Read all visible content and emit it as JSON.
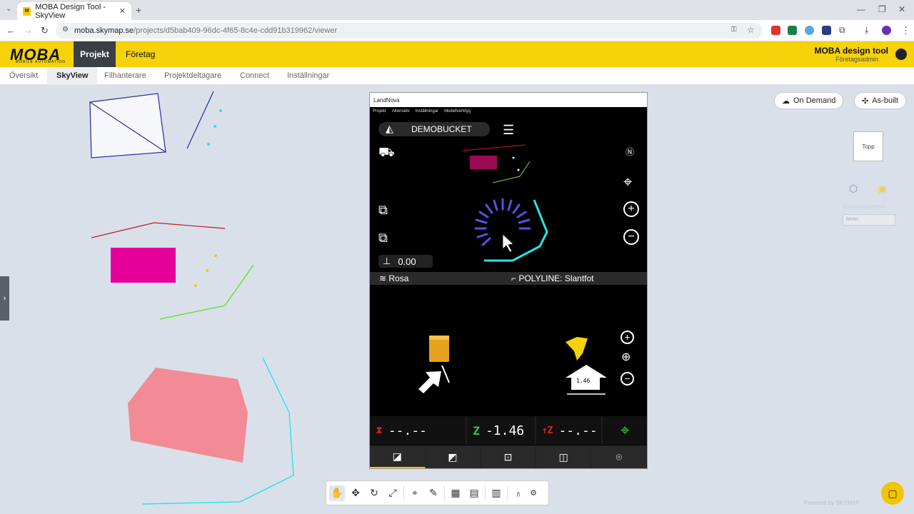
{
  "browser": {
    "tab_title": "MOBA Design Tool - SkyView",
    "favicon_text": "M",
    "url_host": "moba.skymap.se",
    "url_path": "/projects/d5bab409-96dc-4f65-8c4e-cdd91b319962/viewer"
  },
  "header": {
    "logo": "MOBA",
    "logo_sub": "MOBILE AUTOMATION",
    "nav": [
      "Projekt",
      "Företag"
    ],
    "user_name": "MOBA design tool",
    "user_role": "Företagsadmin"
  },
  "subnav": [
    "Översikt",
    "SkyView",
    "Filhanterare",
    "Projektdeltagare",
    "Connect",
    "Inställningar"
  ],
  "map": {
    "on_demand_label": "On Demand",
    "as_built_label": "As-built",
    "view_cube_label": "Topp",
    "unit_select": "Meter",
    "ghost_label": "Koordinatsystem",
    "powered_by": "Powered by SKYMAP"
  },
  "phone": {
    "title": "LandNova",
    "menu": [
      "Projekt",
      "Alternativ",
      "Inställningar",
      "Modellverktyg"
    ],
    "bucket_name": "DEMOBUCKET",
    "height_value": "0.00",
    "layer_name": "Rosa",
    "polyline_label": "POLYLINE: Slantfot",
    "depth_value": "1.46",
    "readout_left": "--.--",
    "z_label": "Z",
    "z_value": "-1.46",
    "dz_label": "↑Z",
    "dz_value": "--.--"
  },
  "colors": {
    "brand_yellow": "#f5d20a",
    "magenta": "#e6009a",
    "salmon": "#f28b95",
    "cyan": "#25e6e6",
    "lime": "#5be52a"
  }
}
